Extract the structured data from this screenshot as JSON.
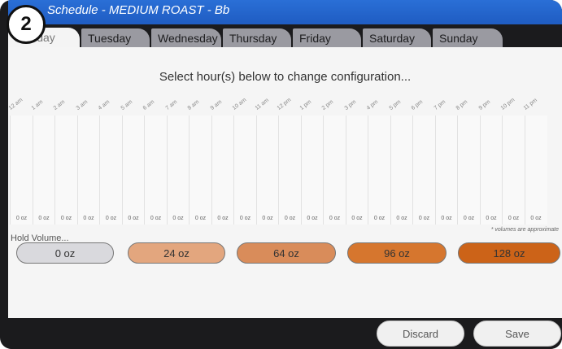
{
  "badge": "2",
  "title": "Schedule - MEDIUM ROAST - Bb",
  "tabs": [
    "Monday",
    "Tuesday",
    "Wednesday",
    "Thursday",
    "Friday",
    "Saturday",
    "Sunday"
  ],
  "instruction": "Select hour(s) below to change configuration...",
  "hours": [
    {
      "label": "12 am",
      "oz": "0 oz"
    },
    {
      "label": "1 am",
      "oz": "0 oz"
    },
    {
      "label": "2 am",
      "oz": "0 oz"
    },
    {
      "label": "3 am",
      "oz": "0 oz"
    },
    {
      "label": "4 am",
      "oz": "0 oz"
    },
    {
      "label": "5 am",
      "oz": "0 oz"
    },
    {
      "label": "6 am",
      "oz": "0 oz"
    },
    {
      "label": "7 am",
      "oz": "0 oz"
    },
    {
      "label": "8 am",
      "oz": "0 oz"
    },
    {
      "label": "9 am",
      "oz": "0 oz"
    },
    {
      "label": "10 am",
      "oz": "0 oz"
    },
    {
      "label": "11 am",
      "oz": "0 oz"
    },
    {
      "label": "12 pm",
      "oz": "0 oz"
    },
    {
      "label": "1 pm",
      "oz": "0 oz"
    },
    {
      "label": "2 pm",
      "oz": "0 oz"
    },
    {
      "label": "3 pm",
      "oz": "0 oz"
    },
    {
      "label": "4 pm",
      "oz": "0 oz"
    },
    {
      "label": "5 pm",
      "oz": "0 oz"
    },
    {
      "label": "6 pm",
      "oz": "0 oz"
    },
    {
      "label": "7 pm",
      "oz": "0 oz"
    },
    {
      "label": "8 pm",
      "oz": "0 oz"
    },
    {
      "label": "9 pm",
      "oz": "0 oz"
    },
    {
      "label": "10 pm",
      "oz": "0 oz"
    },
    {
      "label": "11 pm",
      "oz": "0 oz"
    }
  ],
  "approx_note": "* volumes are approximate",
  "hold_label": "Hold Volume...",
  "volumes": [
    {
      "label": "0 oz",
      "color": "#d9d9dd"
    },
    {
      "label": "24 oz",
      "color": "#e3a67e"
    },
    {
      "label": "64 oz",
      "color": "#d98c5a"
    },
    {
      "label": "96 oz",
      "color": "#d6762e"
    },
    {
      "label": "128 oz",
      "color": "#cc6318"
    }
  ],
  "buttons": {
    "discard": "Discard",
    "save": "Save"
  }
}
